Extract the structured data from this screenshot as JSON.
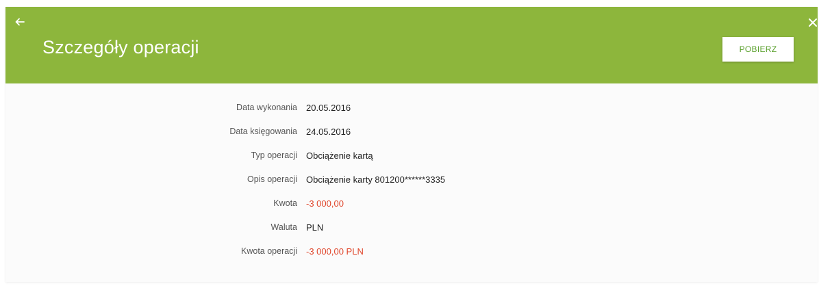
{
  "colors": {
    "header_bg": "#8db63c",
    "accent_green": "#5aa02c",
    "negative": "#e0452a"
  },
  "header": {
    "back_icon": "arrow-left-icon",
    "title": "Szczegóły operacji",
    "download_label": "POBIERZ",
    "close_icon": "close-icon"
  },
  "details": [
    {
      "label": "Data wykonania",
      "value": "20.05.2016"
    },
    {
      "label": "Data księgowania",
      "value": "24.05.2016"
    },
    {
      "label": "Typ operacji",
      "value": "Obciążenie kartą"
    },
    {
      "label": "Opis operacji",
      "value": "Obciążenie  karty 801200******3335"
    },
    {
      "label": "Kwota",
      "value": "-3 000,00"
    },
    {
      "label": "Waluta",
      "value": "PLN"
    },
    {
      "label": "Kwota operacji",
      "value": "-3 000,00  PLN"
    }
  ]
}
